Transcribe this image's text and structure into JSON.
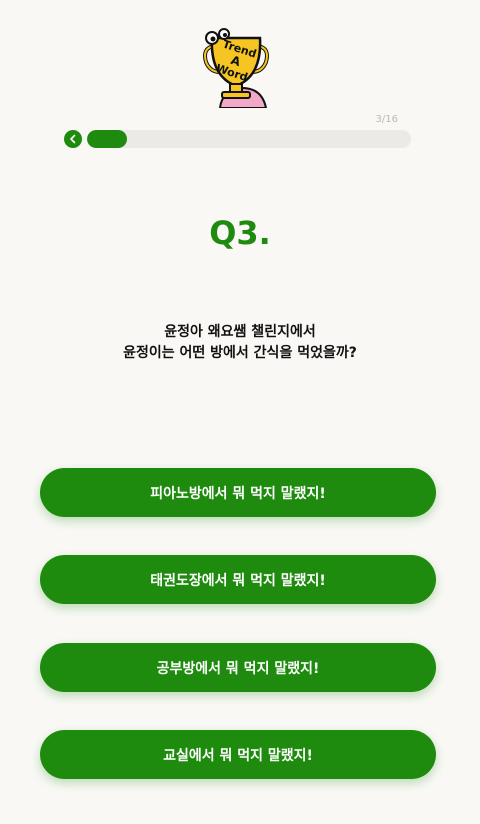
{
  "logo": {
    "icon": "trend-a-word-trophy-logo",
    "text": "Trend A Word"
  },
  "progress": {
    "label": "3/16",
    "current": 3,
    "total": 16,
    "fraction": 0.1875
  },
  "back_icon": "chevron-left-icon",
  "question": {
    "number": "Q3.",
    "line1": "윤정아 왜요쌤 챌린지에서",
    "line2": "윤정이는 어떤 방에서 간식을 먹었을까?"
  },
  "answers": [
    "피아노방에서 뭐 먹지 말랬지!",
    "태권도장에서 뭐 먹지 말랬지!",
    "공부방에서 뭐 먹지 말랬지!",
    "교실에서 뭐 먹지 말랬지!"
  ],
  "colors": {
    "accent": "#1e8b0f",
    "background": "#f9f8f5",
    "track": "#ebeae7"
  }
}
